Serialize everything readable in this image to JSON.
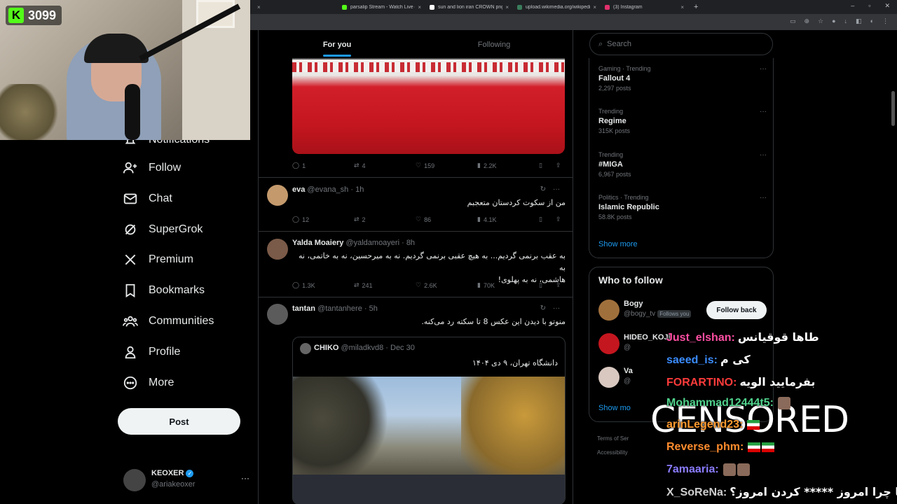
{
  "browser": {
    "tabs": [
      {
        "title": "parsalip Stream - Watch Live o",
        "color": "#53fc18"
      },
      {
        "title": "sun and lion iran CROWN png",
        "color": "#ffffff"
      },
      {
        "title": "upload.wikimedia.org/wikipedi",
        "color": "#3a7d5c"
      },
      {
        "title": "(3) Instagram",
        "color": "#e1306c"
      }
    ],
    "new_tab": "+",
    "close": "×"
  },
  "stream": {
    "viewer_count": "3099",
    "logo": "K"
  },
  "nav": {
    "items": [
      {
        "label": "Notifications",
        "icon": "bell-icon"
      },
      {
        "label": "Follow",
        "icon": "person-plus-icon"
      },
      {
        "label": "Chat",
        "icon": "mail-icon"
      },
      {
        "label": "SuperGrok",
        "icon": "grok-icon"
      },
      {
        "label": "Premium",
        "icon": "x-logo-icon"
      },
      {
        "label": "Bookmarks",
        "icon": "bookmark-icon"
      },
      {
        "label": "Communities",
        "icon": "people-icon"
      },
      {
        "label": "Profile",
        "icon": "person-icon"
      },
      {
        "label": "More",
        "icon": "more-circle-icon"
      }
    ],
    "post_label": "Post",
    "account": {
      "name": "KEOXER",
      "handle": "@ariakeoxer",
      "more": "···"
    }
  },
  "feed": {
    "tabs": [
      {
        "label": "For you",
        "active": true
      },
      {
        "label": "Following",
        "active": false
      }
    ],
    "first_actions": {
      "replies": "1",
      "reposts": "4",
      "likes": "159",
      "views": "2.2K"
    },
    "tweets": [
      {
        "name": "eva",
        "handle": "@evana_sh",
        "time": "· 1h",
        "text": "من از سکوت کردستان متعجبم",
        "replies": "12",
        "reposts": "2",
        "likes": "86",
        "views": "4.1K"
      },
      {
        "name": "Yalda Moaiery",
        "handle": "@yaldamoayeri",
        "time": "· 8h",
        "text_line1": "به عقب برنمی گردیم... به هیچ عقبی برنمی گردیم. نه به میرحسین، نه به خاتمی، نه به",
        "text_line2": "هاشمی، نه به پهلوی!",
        "replies": "1.3K",
        "reposts": "241",
        "likes": "2.6K",
        "views": "70K"
      },
      {
        "name": "tantan",
        "handle": "@tantanhere",
        "time": "· 5h",
        "text": "منوتو با دیدن این عکس 8 تا سکته رد می‌کنه."
      }
    ],
    "quote": {
      "name": "CHIKO",
      "handle": "@miladkvd8",
      "time": "· Dec 30",
      "text": "دانشگاه تهران، ۹ دی ۱۴۰۴"
    }
  },
  "sidebar": {
    "search_placeholder": "Search",
    "trends": [
      {
        "context": "Gaming · Trending",
        "title": "Fallout 4",
        "posts": "2,297 posts"
      },
      {
        "context": "Trending",
        "title": "Regime",
        "posts": "315K posts"
      },
      {
        "context": "Trending",
        "title": "#MIGA",
        "posts": "6,967 posts"
      },
      {
        "context": "Politics · Trending",
        "title": "Islamic Republic",
        "posts": "58.8K posts"
      }
    ],
    "show_more": "Show more",
    "who_to_follow": {
      "title": "Who to follow",
      "users": [
        {
          "name": "Bogy",
          "handle": "@bogy_tv",
          "badge": "Follows you",
          "button": "Follow back"
        },
        {
          "name": "HIDEO_KOJI",
          "handle": "@"
        },
        {
          "name": "Va",
          "handle": "@"
        }
      ],
      "show_more": "Show mo"
    },
    "footer": [
      "Terms of Ser",
      "Accessibility"
    ]
  },
  "chat": {
    "messages": [
      {
        "user": "Just_elshan:",
        "text": "طاها قوقیانس",
        "color": "#ff4fa3"
      },
      {
        "user": "saeed_is:",
        "text": "کی م",
        "color": "#3b8cff"
      },
      {
        "user": "FORARTINO:",
        "text": "بفرمایید الویه",
        "color": "#ff3b3b"
      },
      {
        "user": "Mohammad12444t5:",
        "text": "",
        "color": "#4fd18b"
      },
      {
        "user": "arinLegend23:",
        "text": "",
        "color": "#ff9a2e"
      },
      {
        "user": "Reverse_phm:",
        "text": "",
        "color": "#ff8c2e"
      },
      {
        "user": "7amaaria:",
        "text": "",
        "color": "#8a7cff"
      },
      {
        "user": "X_SoReNa:",
        "text": "تهرانیا چرا امروز ***** کردن امروز؟",
        "color": "#cfcfcf"
      }
    ],
    "overlay": "CENSORED"
  }
}
